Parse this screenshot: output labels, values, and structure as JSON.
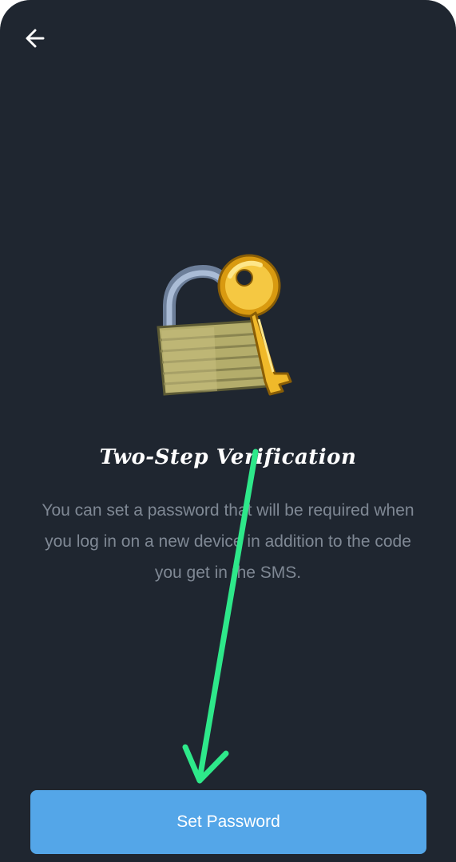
{
  "header": {
    "back_icon": "arrow-left-icon"
  },
  "hero": {
    "icon": "lock-with-key-icon"
  },
  "content": {
    "title": "Two-Step Verification",
    "description": "You can set a password that will be required when you log in on a new device in addition to the code you get in the SMS."
  },
  "actions": {
    "set_password_label": "Set Password"
  },
  "colors": {
    "background": "#1f2630",
    "accent": "#54a6e8",
    "annotation": "#2ee88a",
    "muted_text": "#7f8894"
  }
}
